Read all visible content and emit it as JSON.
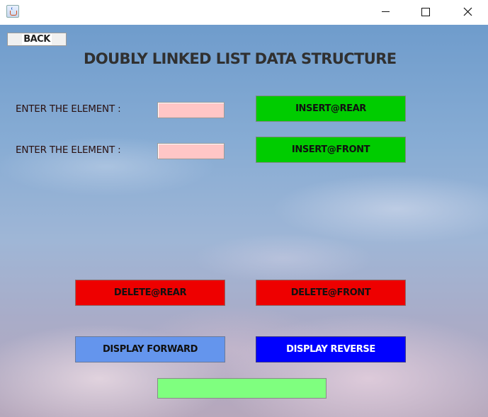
{
  "window": {
    "title": "",
    "controls": {
      "minimize": "minimize",
      "maximize": "maximize",
      "close": "close"
    }
  },
  "header": {
    "back_label": "BACK",
    "title": "DOUBLY LINKED LIST DATA STRUCTURE"
  },
  "form": {
    "rows": [
      {
        "label": "ENTER THE ELEMENT :",
        "value": "",
        "button": "INSERT@REAR"
      },
      {
        "label": "ENTER THE ELEMENT :",
        "value": "",
        "button": "INSERT@FRONT"
      }
    ]
  },
  "actions": {
    "delete_rear": "DELETE@REAR",
    "delete_front": "DELETE@FRONT",
    "display_forward": "DISPLAY FORWARD",
    "display_reverse": "DISPLAY REVERSE"
  },
  "output": {
    "value": ""
  },
  "colors": {
    "insert": "#00cc00",
    "delete": "#ee0000",
    "display_forward": "#6495ed",
    "display_reverse": "#0000ff",
    "input_bg": "#ffc6c6",
    "output_bg": "#7fff7f"
  },
  "icons": {
    "app": "java-app-icon",
    "minimize": "minimize-icon",
    "maximize": "maximize-icon",
    "close": "close-icon"
  }
}
